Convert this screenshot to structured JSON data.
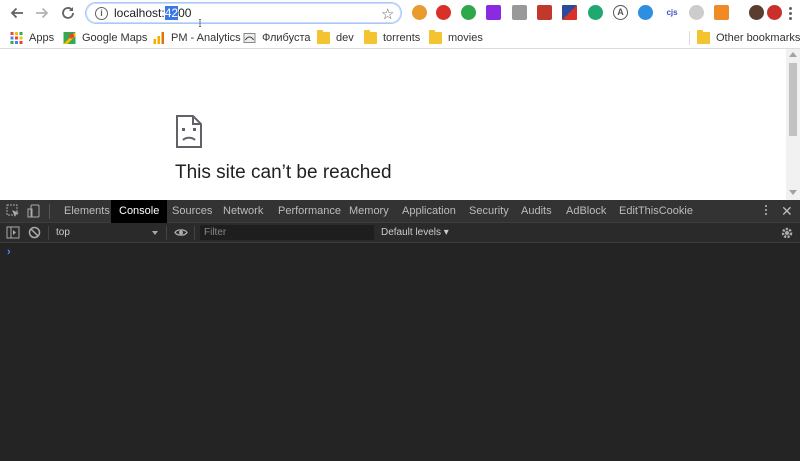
{
  "browser": {
    "url_prefix": "localhost:",
    "url_selected": "42",
    "url_suffix": "00",
    "bookmarks": [
      {
        "label": "Apps",
        "type": "apps"
      },
      {
        "label": "Google Maps",
        "type": "maps"
      },
      {
        "label": "PM - Analytics",
        "type": "analytics"
      },
      {
        "label": "Флибуста",
        "type": "site"
      },
      {
        "label": "dev",
        "type": "folder"
      },
      {
        "label": "torrents",
        "type": "folder"
      },
      {
        "label": "movies",
        "type": "folder"
      }
    ],
    "other_bookmarks": "Other bookmarks"
  },
  "page": {
    "error_title": "This site can’t be reached"
  },
  "devtools": {
    "tabs": [
      "Elements",
      "Console",
      "Sources",
      "Network",
      "Performance",
      "Memory",
      "Application",
      "Security",
      "Audits",
      "AdBlock",
      "EditThisCookie"
    ],
    "active_tab": "Console",
    "context": "top",
    "filter_placeholder": "Filter",
    "levels": "Default levels ▾",
    "prompt": "›"
  },
  "colors": {
    "devtools_bg": "#242424",
    "tab_active_bg": "#000000",
    "selection": "#3b78e7"
  }
}
